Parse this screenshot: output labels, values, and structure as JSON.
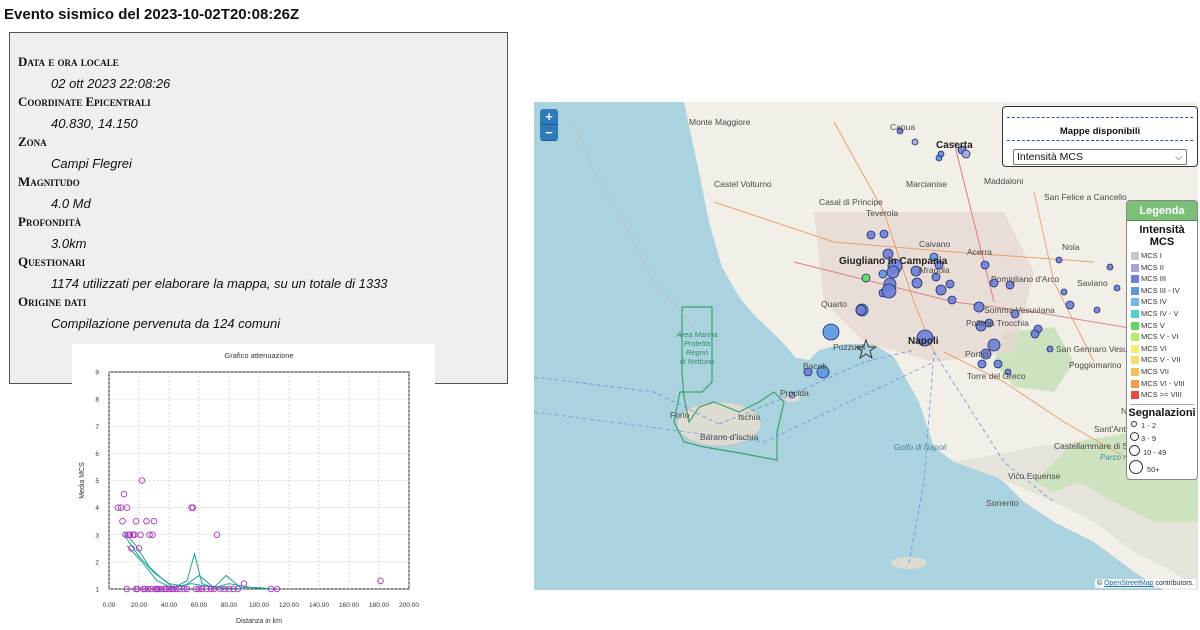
{
  "page": {
    "title": "Evento sismico del 2023-10-02T20:08:26Z"
  },
  "info": [
    {
      "label": "Data e ora locale",
      "value": "02 ott 2023 22:08:26"
    },
    {
      "label": "Coordinate Epicentrali",
      "value": "40.830, 14.150"
    },
    {
      "label": "Zona",
      "value": "Campi Flegrei"
    },
    {
      "label": "Magnitudo",
      "value": "4.0 Md"
    },
    {
      "label": "Profondità",
      "value": "3.0km"
    },
    {
      "label": "Questionari",
      "value": "1174 utilizzati per elaborare la mappa, su un totale di 1333"
    },
    {
      "label": "Origine dati",
      "value": "Compilazione pervenuta da 124 comuni"
    }
  ],
  "chart_data": {
    "type": "scatter",
    "title": "Grafico attenuazione",
    "xlabel": "Distanza in km",
    "ylabel": "Media MCS",
    "xlim": [
      0,
      200
    ],
    "ylim": [
      1,
      9
    ],
    "x_ticks": [
      "0.00",
      "20.00",
      "40.00",
      "60.00",
      "80.00",
      "100.00",
      "120.00",
      "140.00",
      "160.00",
      "180.00",
      "200.00"
    ],
    "y_ticks": [
      "1",
      "2",
      "3",
      "4",
      "5",
      "6",
      "7",
      "8",
      "9"
    ],
    "grid": true,
    "point_color": "#b030c8",
    "line_color": "#1aa59a",
    "points": [
      [
        6,
        4
      ],
      [
        8,
        4
      ],
      [
        9,
        3.5
      ],
      [
        10,
        4.5
      ],
      [
        11,
        3
      ],
      [
        12,
        4
      ],
      [
        12,
        1
      ],
      [
        13,
        3
      ],
      [
        14,
        3
      ],
      [
        15,
        2.5
      ],
      [
        16,
        3
      ],
      [
        17,
        3
      ],
      [
        18,
        3.5
      ],
      [
        18,
        1
      ],
      [
        19,
        1
      ],
      [
        20,
        2.5
      ],
      [
        21,
        3
      ],
      [
        22,
        5
      ],
      [
        23,
        1
      ],
      [
        24,
        1
      ],
      [
        25,
        3.5
      ],
      [
        26,
        1
      ],
      [
        27,
        3
      ],
      [
        28,
        1
      ],
      [
        29,
        3
      ],
      [
        30,
        3.5
      ],
      [
        31,
        1
      ],
      [
        32,
        1
      ],
      [
        33,
        1
      ],
      [
        35,
        1
      ],
      [
        37,
        1
      ],
      [
        38,
        1
      ],
      [
        40,
        1
      ],
      [
        42,
        1
      ],
      [
        43,
        1
      ],
      [
        45,
        1
      ],
      [
        47,
        1
      ],
      [
        50,
        1
      ],
      [
        52,
        1
      ],
      [
        55,
        4
      ],
      [
        56,
        4
      ],
      [
        58,
        1
      ],
      [
        60,
        1
      ],
      [
        62,
        1
      ],
      [
        65,
        1
      ],
      [
        68,
        1
      ],
      [
        70,
        1
      ],
      [
        72,
        3
      ],
      [
        74,
        1
      ],
      [
        77,
        1
      ],
      [
        80,
        1
      ],
      [
        83,
        1
      ],
      [
        86,
        1
      ],
      [
        90,
        1.2
      ],
      [
        108,
        1
      ],
      [
        112,
        1
      ],
      [
        181,
        1.3
      ]
    ],
    "series": [
      {
        "x": [
          10,
          18,
          27,
          35,
          43,
          52,
          57,
          62,
          70,
          78,
          88,
          100,
          110
        ],
        "values": [
          3.1,
          2.6,
          1.8,
          1.4,
          1.05,
          1.3,
          2.3,
          1.2,
          1.05,
          1.5,
          1.05,
          1.05,
          1.0
        ]
      },
      {
        "x": [
          10,
          20,
          30,
          40,
          50,
          60,
          70,
          80,
          95,
          110
        ],
        "values": [
          3.0,
          2.2,
          1.6,
          1.2,
          1.1,
          1.5,
          1.05,
          1.2,
          1.05,
          1.0
        ]
      },
      {
        "x": [
          12,
          22,
          32,
          42,
          55,
          65,
          75,
          90
        ],
        "values": [
          2.6,
          2.0,
          1.3,
          1.05,
          1.2,
          1.1,
          1.05,
          1.0
        ]
      }
    ]
  },
  "map": {
    "zoom_in": "+",
    "zoom_out": "−",
    "maps_panel": {
      "title": "Mappe disponibili",
      "selected": "Intensità MCS"
    },
    "legend": {
      "title": "Legenda",
      "intensity_title": "Intensità MCS",
      "items": [
        {
          "label": "MCS I",
          "color": "#c8c8c8"
        },
        {
          "label": "MCS II",
          "color": "#a7a6d9"
        },
        {
          "label": "MCS III",
          "color": "#6f7fd6"
        },
        {
          "label": "MCS III - IV",
          "color": "#5b98de"
        },
        {
          "label": "MCS IV",
          "color": "#6fb6ec"
        },
        {
          "label": "MCS IV - V",
          "color": "#4fcfc8"
        },
        {
          "label": "MCS V",
          "color": "#5fd85e"
        },
        {
          "label": "MCS V - VI",
          "color": "#b3ef5c"
        },
        {
          "label": "MCS VI",
          "color": "#f3ef6a"
        },
        {
          "label": "MCS V - VII",
          "color": "#f5df6b"
        },
        {
          "label": "MCS VII",
          "color": "#f4c158"
        },
        {
          "label": "MCS VI - VIII",
          "color": "#f09a50"
        },
        {
          "label": "MCS >= VIII",
          "color": "#e7493e"
        }
      ],
      "reports_title": "Segnalazioni",
      "reports": [
        {
          "label": "1 - 2"
        },
        {
          "label": "3 - 9"
        },
        {
          "label": "10 - 49"
        },
        {
          "label": "50+"
        }
      ]
    },
    "places": [
      "Monte Maggiore",
      "Capua",
      "Caserta",
      "Castel Volturno",
      "Casal di Principe",
      "Marcianise",
      "Maddaloni",
      "Teverola",
      "San Felice a Cancello",
      "Giugliano in Campania",
      "Caivano",
      "Acerra",
      "Afragola",
      "Nola",
      "Pomigliano d'Arco",
      "Saviano",
      "Quarto",
      "Somma Vesuviana",
      "Pollena Trocchia",
      "Pozzuoli",
      "Napoli",
      "Bacoli",
      "Portici",
      "Torre del Greco",
      "Poggiomarino",
      "San Gennaro Vesuviano",
      "Procida",
      "Forio",
      "Ischia",
      "Barano d'Ischia",
      "Golfo di Napoli",
      "Castellammare di Stabia",
      "Vico Equense",
      "Sorrento",
      "Sant'Antonio Abate",
      "Nocera",
      "Parco regionale dei Monti Lattari",
      "Area Marina Protetta Regno di Nettuno"
    ],
    "attribution": {
      "prefix": "©",
      "link": "OpenStreetMap",
      "suffix": "contributors."
    }
  }
}
